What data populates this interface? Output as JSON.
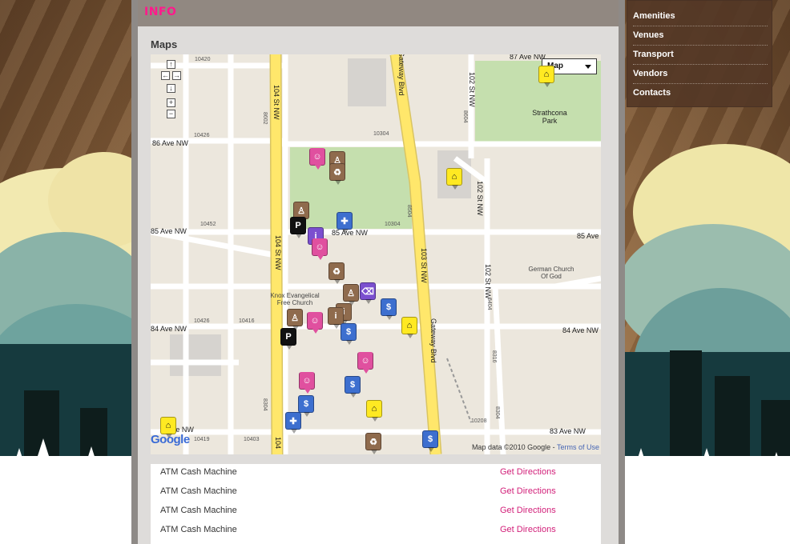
{
  "info": {
    "title": "INFO"
  },
  "maps": {
    "title": "Maps"
  },
  "map": {
    "map_type": "Map",
    "streets": {
      "ave87": "87 Ave NW",
      "ave86": "86 Ave NW",
      "ave85_left": "85 Ave NW",
      "ave85_mid": "85 Ave NW",
      "ave85_right": "85 Ave",
      "ave84_left": "84 Ave NW",
      "ave84_right": "84 Ave NW",
      "ave83": "83 Ave NW",
      "ave83_left": "3 Ave NW",
      "st104_top": "104 St NW",
      "st104_mid": "104 St NW",
      "st104_bot": "104",
      "st103": "103 St NW",
      "gateway_top": "Gateway Blvd",
      "gateway_mid": "Gateway Blvd",
      "st102_top": "102 St NW",
      "st102_mid": "102 St NW",
      "st102_lower": "102 St NW"
    },
    "places": {
      "park": "Strathcona Park",
      "church_german": "German Church Of God",
      "church_knox": "Knox Evangelical Free Church"
    },
    "numbers": [
      "10420",
      "10426",
      "8602",
      "10304",
      "8604",
      "10452",
      "8504",
      "10304",
      "10416",
      "10426",
      "8404",
      "8316",
      "10419",
      "10403",
      "10208",
      "8304",
      "8304"
    ],
    "attribution": "Map data ©2010 Google -",
    "terms": "Terms of Use",
    "logo": "Google"
  },
  "list": {
    "rows": [
      {
        "name": "ATM Cash Machine",
        "link": "Get Directions"
      },
      {
        "name": "ATM Cash Machine",
        "link": "Get Directions"
      },
      {
        "name": "ATM Cash Machine",
        "link": "Get Directions"
      },
      {
        "name": "ATM Cash Machine",
        "link": "Get Directions"
      }
    ]
  },
  "menu": {
    "items": [
      "Amenities",
      "Venues",
      "Transport",
      "Vendors",
      "Contacts"
    ]
  },
  "colors": {
    "accent": "#ff1a8c",
    "link": "#d21f79",
    "menu_bg": "#543826",
    "road_major": "#ffe76b",
    "park": "#c5dfae"
  },
  "icons": [
    "up-arrow-icon",
    "left-arrow-icon",
    "right-arrow-icon",
    "down-arrow-icon",
    "zoom-in-icon",
    "zoom-out-icon",
    "caret-down-icon",
    "theater-icon",
    "recycle-icon",
    "restroom-icon",
    "parking-bike-icon",
    "atm-icon",
    "house-icon",
    "info-icon",
    "trash-icon",
    "bus-stop-icon",
    "first-aid-icon"
  ]
}
